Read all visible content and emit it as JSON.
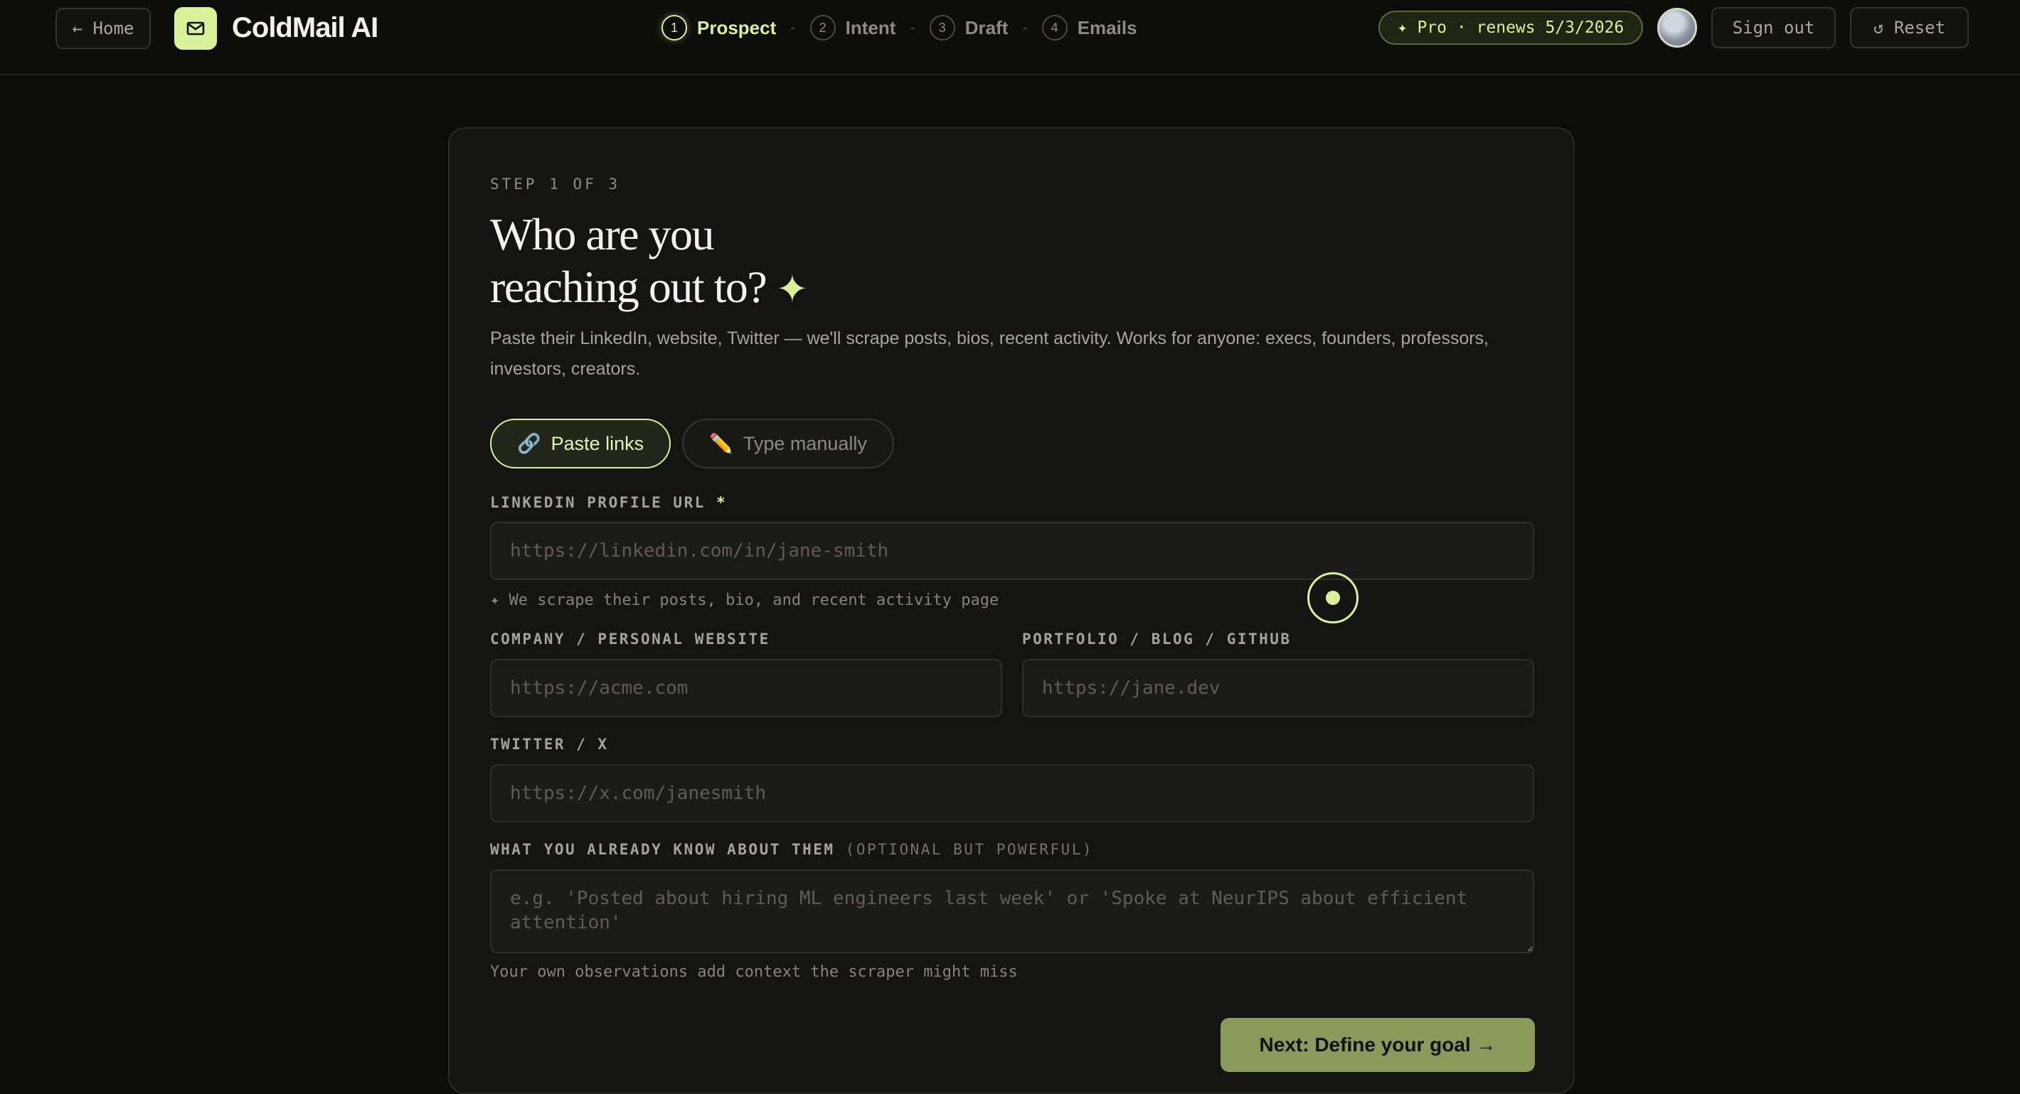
{
  "header": {
    "home_label": "← Home",
    "brand": "ColdMail AI",
    "steps": [
      {
        "num": "1",
        "label": "Prospect"
      },
      {
        "num": "2",
        "label": "Intent"
      },
      {
        "num": "3",
        "label": "Draft"
      },
      {
        "num": "4",
        "label": "Emails"
      }
    ],
    "active_step": 1,
    "step_separator": "-",
    "pro_badge": "✦ Pro · renews 5/3/2026",
    "signout_label": "Sign out",
    "reset_label": "↺ Reset"
  },
  "card": {
    "eyebrow": "STEP 1 OF 3",
    "headline_line1": "Who are you",
    "headline_line2": "reaching out to?",
    "headline_sparkle": "✦",
    "subtitle": "Paste their LinkedIn, website, Twitter — we'll scrape posts, bios, recent activity. Works for anyone: execs, founders, professors, investors, creators.",
    "tabs": [
      {
        "icon": "🔗",
        "label": "Paste links",
        "active": true
      },
      {
        "icon": "✏️",
        "label": "Type manually",
        "active": false
      }
    ],
    "linkedin": {
      "label": "LINKEDIN PROFILE URL",
      "required_mark": "*",
      "placeholder": "https://linkedin.com/in/jane-smith",
      "hint": "✦ We scrape their posts, bio, and recent activity page"
    },
    "website": {
      "label": "COMPANY / PERSONAL WEBSITE",
      "placeholder": "https://acme.com"
    },
    "portfolio": {
      "label": "PORTFOLIO / BLOG / GITHUB",
      "placeholder": "https://jane.dev"
    },
    "twitter": {
      "label": "TWITTER / X",
      "placeholder": "https://x.com/janesmith"
    },
    "notes": {
      "label": "WHAT YOU ALREADY KNOW ABOUT THEM",
      "label_optional": "(OPTIONAL BUT POWERFUL)",
      "placeholder": "e.g. 'Posted about hiring ML engineers last week' or 'Spoke at NeurIPS about efficient attention'",
      "hint": "Your own observations add context the scraper might miss"
    },
    "next_label": "Next: Define your goal →"
  },
  "colors": {
    "accent": "#d9f29a",
    "background": "#0c0c0b",
    "card": "#141413",
    "next_button": "#8a9a5b"
  }
}
